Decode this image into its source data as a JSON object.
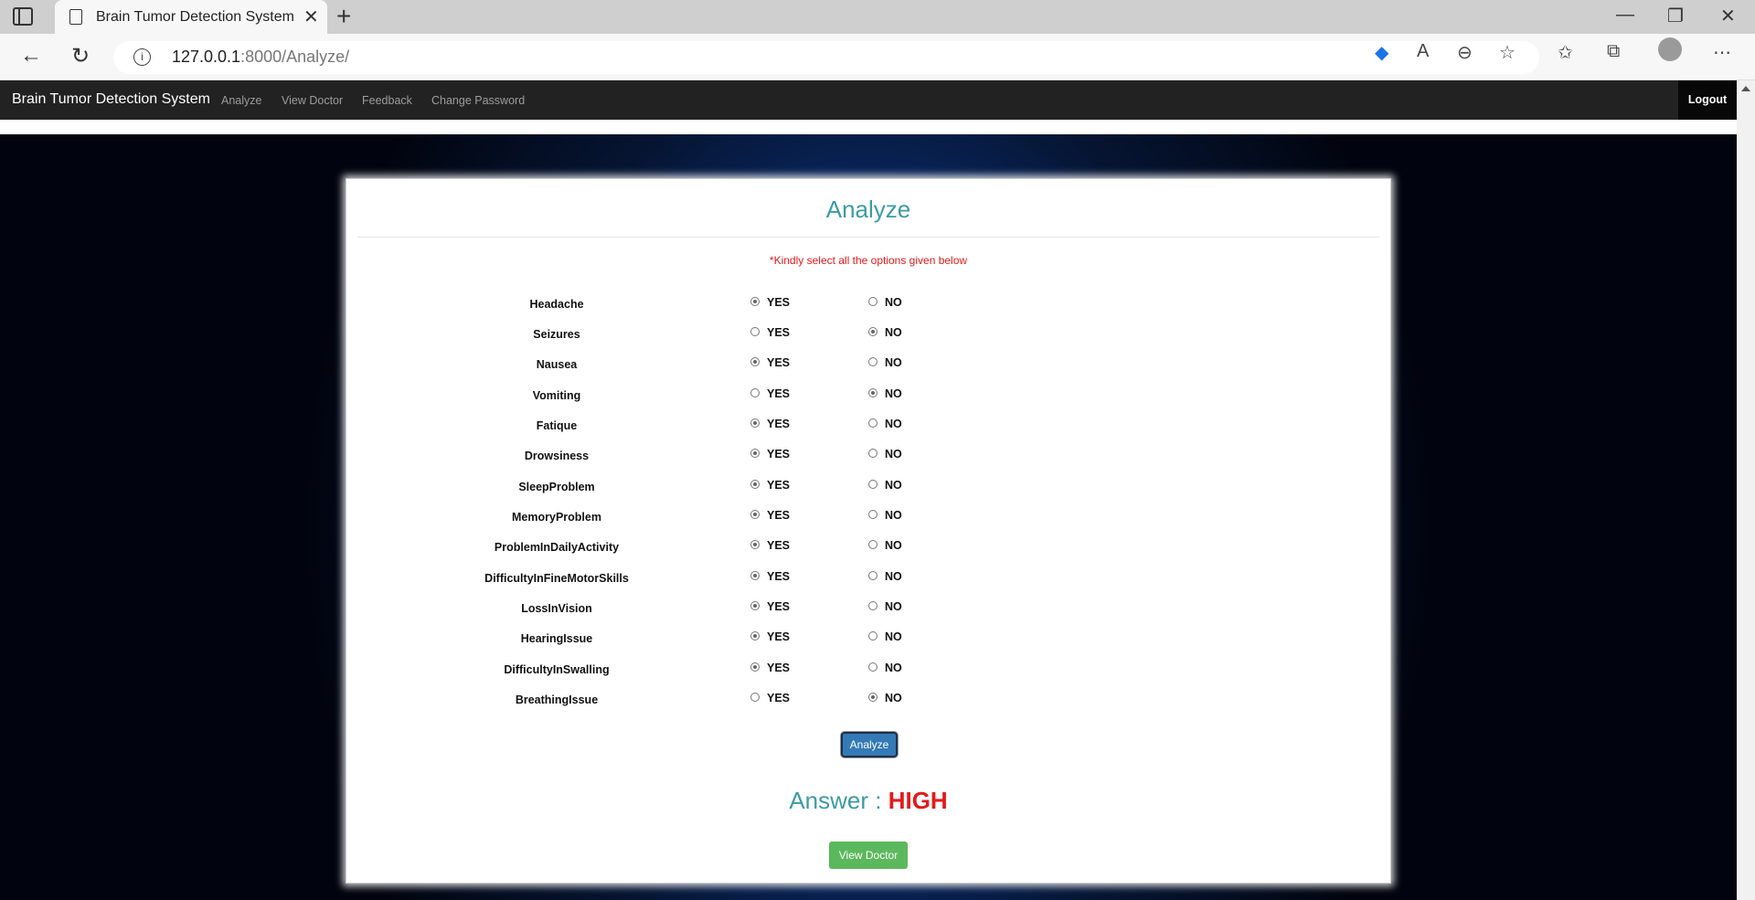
{
  "browser": {
    "tab_title": "Brain Tumor Detection System",
    "url_host": "127.0.0.1",
    "url_rest": ":8000/Analyze/"
  },
  "nav": {
    "brand": "Brain Tumor Detection System",
    "links": [
      "Analyze",
      "View Doctor",
      "Feedback",
      "Change Password"
    ],
    "logout": "Logout"
  },
  "form": {
    "title": "Analyze",
    "notice": "*Kindly select all the options given below",
    "yes_label": "YES",
    "no_label": "NO",
    "questions": [
      {
        "label": "Headache",
        "value": "YES"
      },
      {
        "label": "Seizures",
        "value": "NO"
      },
      {
        "label": "Nausea",
        "value": "YES"
      },
      {
        "label": "Vomiting",
        "value": "NO"
      },
      {
        "label": "Fatique",
        "value": "YES"
      },
      {
        "label": "Drowsiness",
        "value": "YES"
      },
      {
        "label": "SleepProblem",
        "value": "YES"
      },
      {
        "label": "MemoryProblem",
        "value": "YES"
      },
      {
        "label": "ProblemInDailyActivity",
        "value": "YES"
      },
      {
        "label": "DifficultyInFineMotorSkills",
        "value": "YES"
      },
      {
        "label": "LossInVision",
        "value": "YES"
      },
      {
        "label": "HearingIssue",
        "value": "YES"
      },
      {
        "label": "DifficultyInSwalling",
        "value": "YES"
      },
      {
        "label": "BreathingIssue",
        "value": "NO"
      }
    ],
    "submit_label": "Analyze"
  },
  "result": {
    "prefix": "Answer : ",
    "value": "HIGH",
    "view_doctor_label": "View Doctor"
  },
  "colors": {
    "accent": "#3c9ba6",
    "alert": "#e41a1a",
    "primary_button": "#337ab7",
    "success_button": "#5cb85c"
  }
}
